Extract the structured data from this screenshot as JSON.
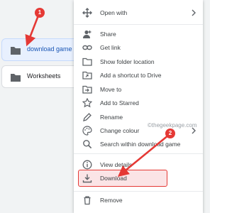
{
  "folders": [
    {
      "label": "download game",
      "icon": "folder-icon",
      "selected": true
    },
    {
      "label": "Worksheets",
      "icon": "folder-icon",
      "selected": false
    }
  ],
  "menu": {
    "open_with": "Open with",
    "share": "Share",
    "get_link": "Get link",
    "show_folder_location": "Show folder location",
    "add_shortcut": "Add a shortcut to Drive",
    "move_to": "Move to",
    "add_to_starred": "Add to Starred",
    "rename": "Rename",
    "change_colour": "Change colour",
    "search_within": "Search within download game",
    "view_details": "View details",
    "download": "Download",
    "remove": "Remove"
  },
  "annotations": {
    "step1": "1",
    "step2": "2",
    "watermark": "©thegeekpage.com"
  },
  "colors": {
    "annotation_red": "#e53935",
    "selected_blue": "#1a56b5",
    "menu_text": "#3c4043"
  }
}
